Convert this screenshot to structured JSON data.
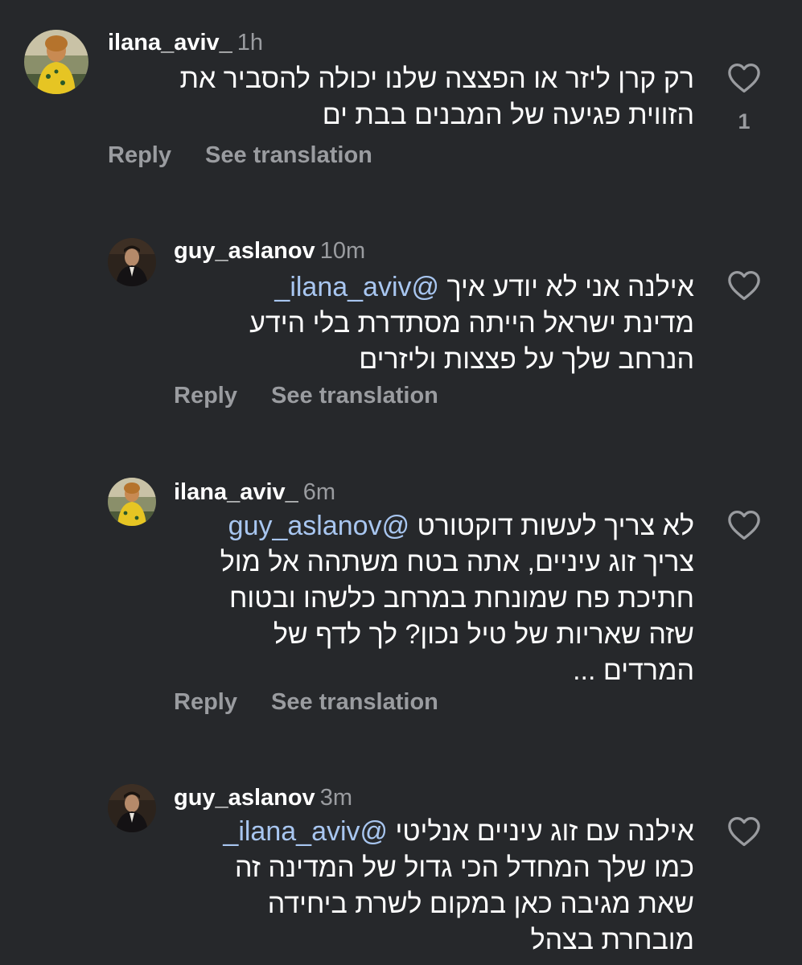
{
  "comments": [
    {
      "username": "ilana_aviv_",
      "time": "1h",
      "lines": [
        [
          {
            "text": "רק קרן ליזר או הפצצה שלנו יכולה להסביר את"
          }
        ],
        [
          {
            "text": "הזווית פגיעה של המבנים בבת ים"
          }
        ]
      ],
      "reply": "Reply",
      "see_translation": "See translation",
      "like_count": "1",
      "avatar": "woman-yellow-dress"
    },
    {
      "username": "guy_aslanov",
      "time": "10m",
      "lines": [
        [
          {
            "text": "אילנה אני לא יודע איך "
          },
          {
            "text": "@ilana_aviv_",
            "mention": true
          }
        ],
        [
          {
            "text": "מדינת ישראל הייתה מסתדרת בלי הידע"
          }
        ],
        [
          {
            "text": "הנרחב שלך על פצצות וליזרים"
          }
        ]
      ],
      "reply": "Reply",
      "see_translation": "See translation",
      "avatar": "man-dark-jacket"
    },
    {
      "username": "ilana_aviv_",
      "time": "6m",
      "lines": [
        [
          {
            "text": "לא צריך לעשות דוקטורט "
          },
          {
            "text": "@guy_aslanov",
            "mention": true
          }
        ],
        [
          {
            "text": "צריך זוג עיניים, אתה בטח משתהה אל מול"
          }
        ],
        [
          {
            "text": "חתיכת פח שמונחת במרחב כלשהו ובטוח"
          }
        ],
        [
          {
            "text": "שזה שאריות של טיל נכון? לך לדף של"
          }
        ],
        [
          {
            "text": "המרדים ..."
          }
        ]
      ],
      "reply": "Reply",
      "see_translation": "See translation",
      "avatar": "woman-yellow-dress"
    },
    {
      "username": "guy_aslanov",
      "time": "3m",
      "lines": [
        [
          {
            "text": "אילנה עם זוג עיניים אנליטי "
          },
          {
            "text": "@ilana_aviv_",
            "mention": true
          }
        ],
        [
          {
            "text": "כמו שלך המחדל הכי גדול של המדינה זה"
          }
        ],
        [
          {
            "text": "שאת מגיבה כאן במקום לשרת ביחידה"
          }
        ],
        [
          {
            "text": "מובחרת בצהל"
          }
        ]
      ],
      "avatar": "man-dark-jacket"
    }
  ],
  "icons": {
    "like": "heart-outline-icon"
  },
  "colors": {
    "background": "#26282b",
    "text": "#ffffff",
    "muted": "#9a9ca0",
    "mention": "#a8c6f0"
  }
}
